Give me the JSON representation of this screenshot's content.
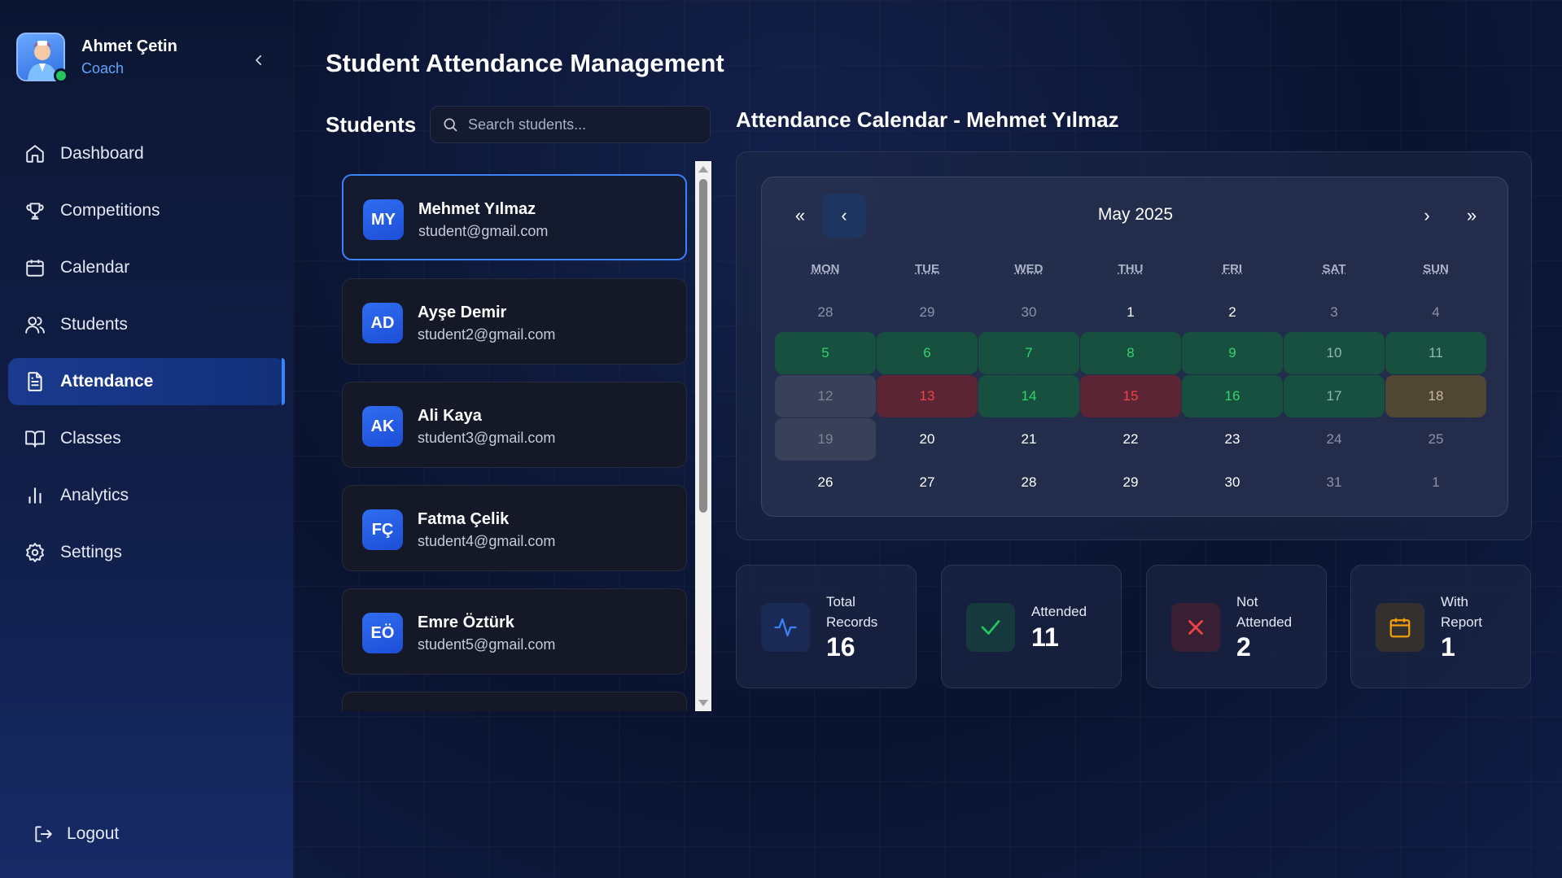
{
  "profile": {
    "name": "Ahmet Çetin",
    "role": "Coach"
  },
  "nav": {
    "items": [
      {
        "label": "Dashboard",
        "icon": "home-icon"
      },
      {
        "label": "Competitions",
        "icon": "trophy-icon"
      },
      {
        "label": "Calendar",
        "icon": "calendar-icon"
      },
      {
        "label": "Students",
        "icon": "users-icon"
      },
      {
        "label": "Attendance",
        "icon": "document-icon",
        "active": true
      },
      {
        "label": "Classes",
        "icon": "book-icon"
      },
      {
        "label": "Analytics",
        "icon": "bar-chart-icon"
      },
      {
        "label": "Settings",
        "icon": "gear-icon"
      }
    ],
    "logout": "Logout"
  },
  "page": {
    "title": "Student Attendance Management"
  },
  "students": {
    "heading": "Students",
    "search_placeholder": "Search students...",
    "list": [
      {
        "initials": "MY",
        "name": "Mehmet Yılmaz",
        "email": "student@gmail.com",
        "selected": true
      },
      {
        "initials": "AD",
        "name": "Ayşe Demir",
        "email": "student2@gmail.com"
      },
      {
        "initials": "AK",
        "name": "Ali Kaya",
        "email": "student3@gmail.com"
      },
      {
        "initials": "FÇ",
        "name": "Fatma Çelik",
        "email": "student4@gmail.com"
      },
      {
        "initials": "EÖ",
        "name": "Emre Öztürk",
        "email": "student5@gmail.com"
      }
    ]
  },
  "calendar": {
    "heading": "Attendance Calendar - Mehmet Yılmaz",
    "month": "May 2025",
    "nav": {
      "prev_year": "«",
      "prev_month": "‹",
      "next_month": "›",
      "next_year": "»"
    },
    "weekdays": [
      "MON",
      "TUE",
      "WED",
      "THU",
      "FRI",
      "SAT",
      "SUN"
    ],
    "weeks": [
      [
        {
          "d": "28",
          "s": "muted"
        },
        {
          "d": "29",
          "s": "muted"
        },
        {
          "d": "30",
          "s": "muted"
        },
        {
          "d": "1",
          "s": "normal"
        },
        {
          "d": "2",
          "s": "normal"
        },
        {
          "d": "3",
          "s": "muted"
        },
        {
          "d": "4",
          "s": "muted"
        }
      ],
      [
        {
          "d": "5",
          "s": "present"
        },
        {
          "d": "6",
          "s": "present"
        },
        {
          "d": "7",
          "s": "present"
        },
        {
          "d": "8",
          "s": "present"
        },
        {
          "d": "9",
          "s": "present"
        },
        {
          "d": "10",
          "s": "present-dim"
        },
        {
          "d": "11",
          "s": "present-dim"
        }
      ],
      [
        {
          "d": "12",
          "s": "blank"
        },
        {
          "d": "13",
          "s": "absent"
        },
        {
          "d": "14",
          "s": "present"
        },
        {
          "d": "15",
          "s": "absent"
        },
        {
          "d": "16",
          "s": "present"
        },
        {
          "d": "17",
          "s": "present-dim"
        },
        {
          "d": "18",
          "s": "report"
        }
      ],
      [
        {
          "d": "19",
          "s": "blank"
        },
        {
          "d": "20",
          "s": "normal"
        },
        {
          "d": "21",
          "s": "normal"
        },
        {
          "d": "22",
          "s": "normal"
        },
        {
          "d": "23",
          "s": "normal"
        },
        {
          "d": "24",
          "s": "muted"
        },
        {
          "d": "25",
          "s": "muted"
        }
      ],
      [
        {
          "d": "26",
          "s": "normal"
        },
        {
          "d": "27",
          "s": "normal"
        },
        {
          "d": "28",
          "s": "normal"
        },
        {
          "d": "29",
          "s": "normal"
        },
        {
          "d": "30",
          "s": "normal"
        },
        {
          "d": "31",
          "s": "muted"
        },
        {
          "d": "1",
          "s": "muted"
        }
      ]
    ]
  },
  "stats": [
    {
      "label_line1": "Total",
      "label_line2": "Records",
      "value": "16",
      "icon": "activity-icon",
      "color": "#3b82f6"
    },
    {
      "label_line1": "Attended",
      "label_line2": "",
      "value": "11",
      "icon": "check-icon",
      "color": "#22c55e"
    },
    {
      "label_line1": "Not",
      "label_line2": "Attended",
      "value": "2",
      "icon": "x-icon",
      "color": "#ef4444"
    },
    {
      "label_line1": "With",
      "label_line2": "Report",
      "value": "1",
      "icon": "calendar-icon",
      "color": "#f59e0b"
    }
  ]
}
